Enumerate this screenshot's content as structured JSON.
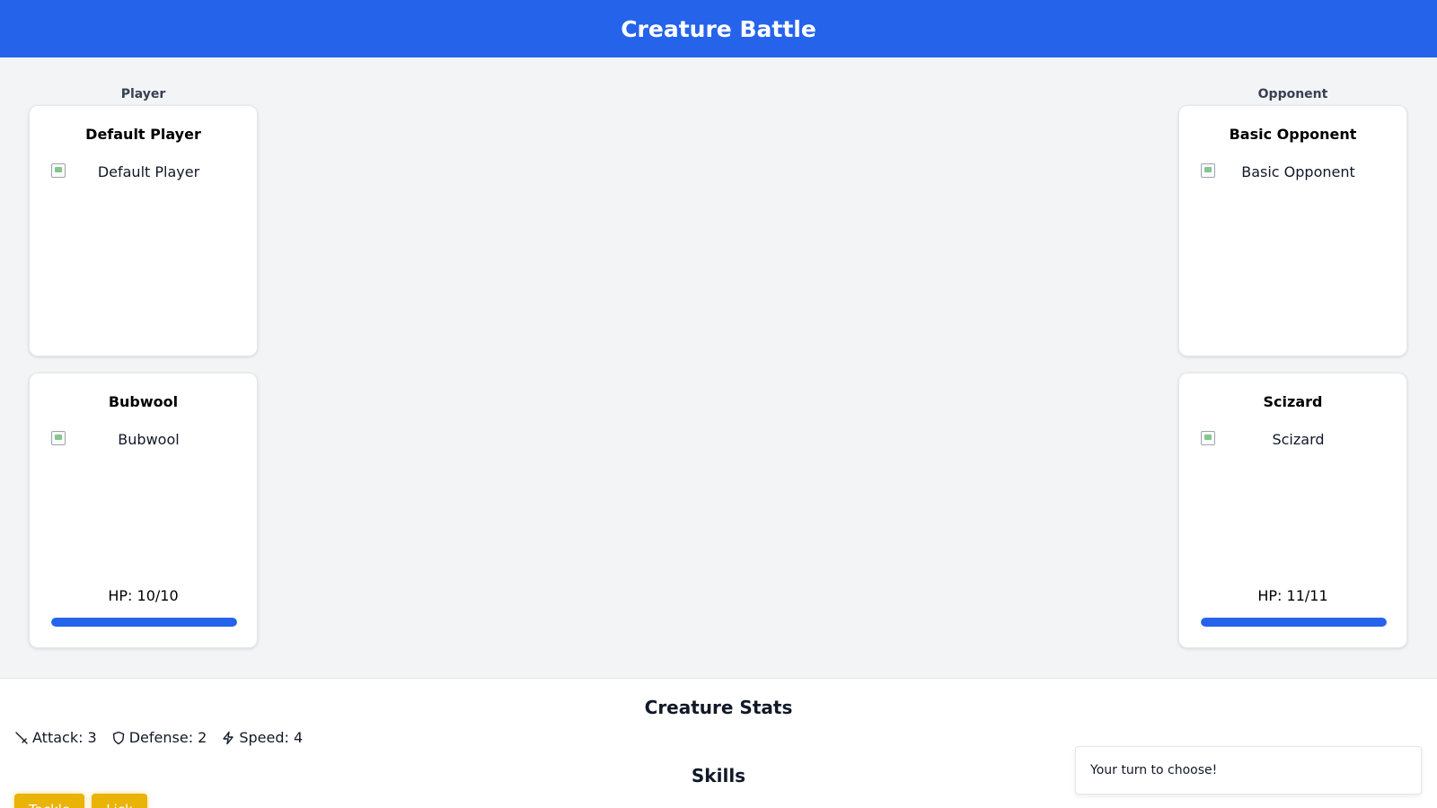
{
  "header": {
    "title": "Creature Battle"
  },
  "player": {
    "side_label": "Player",
    "trainer": {
      "name": "Default Player",
      "image_alt": "Default Player"
    },
    "creature": {
      "name": "Bubwool",
      "image_alt": "Bubwool",
      "hp_text": "HP: 10/10",
      "hp_fraction": 1.0
    }
  },
  "opponent": {
    "side_label": "Opponent",
    "trainer": {
      "name": "Basic Opponent",
      "image_alt": "Basic Opponent"
    },
    "creature": {
      "name": "Scizard",
      "image_alt": "Scizard",
      "hp_text": "HP: 11/11",
      "hp_fraction": 1.0
    }
  },
  "stats": {
    "title": "Creature Stats",
    "attack": "Attack: 3",
    "defense": "Defense: 2",
    "speed": "Speed: 4",
    "attack_icon": "sword-icon",
    "defense_icon": "shield-icon",
    "speed_icon": "lightning-icon"
  },
  "skills": {
    "title": "Skills",
    "buttons": [
      "Tackle",
      "Lick"
    ]
  },
  "toast": {
    "message": "Your turn to choose!"
  },
  "colors": {
    "primary": "#2563eb",
    "skill_button": "#eab308",
    "background": "#f3f4f6"
  }
}
